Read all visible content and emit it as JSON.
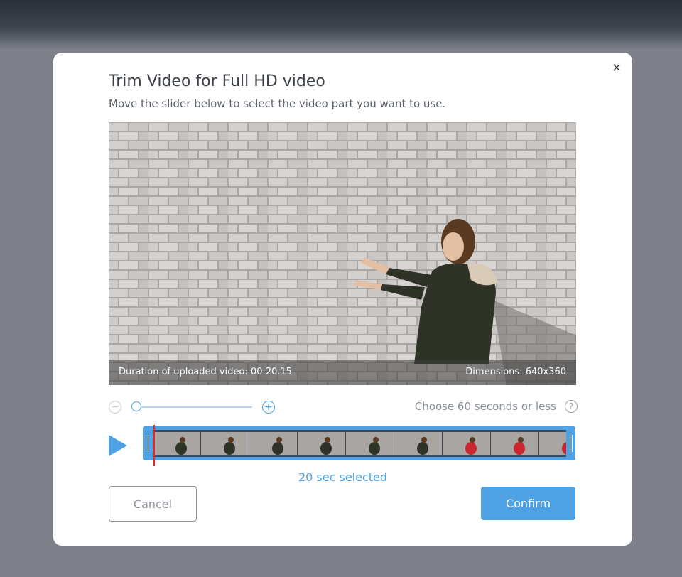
{
  "modal": {
    "title": "Trim Video for Full HD video",
    "subtitle": "Move the slider below to select the video part you want to use.",
    "close_icon": "×"
  },
  "video": {
    "duration_text": "Duration of uploaded video: 00:20.15",
    "dimensions_text": "Dimensions: 640x360"
  },
  "zoom": {
    "minus_icon": "−",
    "plus_icon": "+",
    "level": 0
  },
  "limit": {
    "text": "Choose 60 seconds or less",
    "help_icon": "?"
  },
  "timeline": {
    "selected_text": "20 sec selected"
  },
  "actions": {
    "cancel_label": "Cancel",
    "confirm_label": "Confirm"
  },
  "colors": {
    "accent": "#4ea1e3",
    "playhead": "#e2262a"
  }
}
